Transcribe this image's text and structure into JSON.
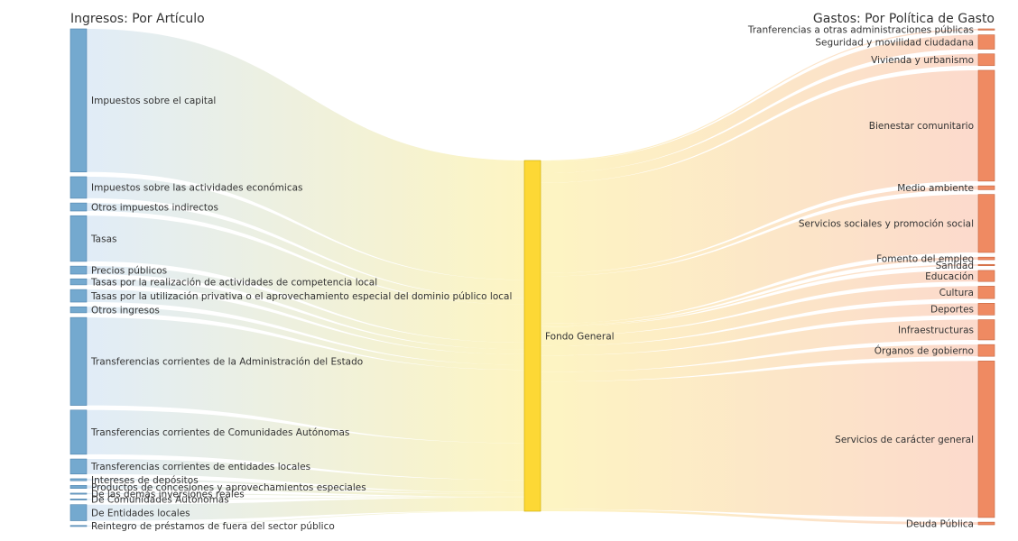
{
  "chart_data": {
    "type": "sankey",
    "title_left": "Ingresos: Por Artículo",
    "title_right": "Gastos: Por Política de Gasto",
    "middle_node": "Fondo General",
    "colors": {
      "income_node": "#74a9cf",
      "middle_node": "#fdd835",
      "expense_node": "#ef8a62",
      "link_from": "#dbe9f6",
      "link_mid": "#fdf3b8",
      "link_to": "#fbd3c3"
    },
    "income": [
      {
        "label": "Impuestos sobre el capital",
        "value": 28.5
      },
      {
        "label": "Impuestos sobre las actividades económicas",
        "value": 4.3
      },
      {
        "label": "Otros impuestos indirectos",
        "value": 1.6
      },
      {
        "label": "Tasas",
        "value": 9.1
      },
      {
        "label": "Precios públicos",
        "value": 1.6
      },
      {
        "label": "Tasas por la realización de actividades de competencia local",
        "value": 1.2
      },
      {
        "label": "Tasas por la utilización privativa o el aprovechamiento especial del dominio público local",
        "value": 2.5
      },
      {
        "label": "Otros ingresos",
        "value": 1.2
      },
      {
        "label": "Transferencias corrientes de la Administración del Estado",
        "value": 17.5
      },
      {
        "label": "Transferencias corrientes de Comunidades Autónomas",
        "value": 8.8
      },
      {
        "label": "Transferencias corrientes de entidades locales",
        "value": 3.0
      },
      {
        "label": "Intereses de depósitos",
        "value": 0.4
      },
      {
        "label": "Productos de concesiones y aprovechamientos especiales",
        "value": 0.6
      },
      {
        "label": "De las demás inversiones reales",
        "value": 0.1
      },
      {
        "label": "De Comunidades Autónomas",
        "value": 0.1
      },
      {
        "label": "De Entidades locales",
        "value": 3.2
      },
      {
        "label": "Reintegro de préstamos de fuera del sector público",
        "value": 0.1
      }
    ],
    "expenses": [
      {
        "label": "Tranferencias a otras administraciones públicas",
        "value": 0.2
      },
      {
        "label": "Seguridad y movilidad ciudadana",
        "value": 2.2
      },
      {
        "label": "Vivienda y urbanismo",
        "value": 1.8
      },
      {
        "label": "Bienestar comunitario",
        "value": 17.0
      },
      {
        "label": "Medio ambiente",
        "value": 0.6
      },
      {
        "label": "Servicios sociales y promoción social",
        "value": 8.9
      },
      {
        "label": "Fomento del empleo",
        "value": 0.4
      },
      {
        "label": "Sanidad",
        "value": 0.2
      },
      {
        "label": "Educación",
        "value": 1.7
      },
      {
        "label": "Cultura",
        "value": 1.9
      },
      {
        "label": "Deportes",
        "value": 1.8
      },
      {
        "label": "Infraestructuras",
        "value": 3.1
      },
      {
        "label": "Órganos de gobierno",
        "value": 1.8
      },
      {
        "label": "Servicios de carácter general",
        "value": 24.0
      },
      {
        "label": "Deuda Pública",
        "value": 0.4
      }
    ]
  }
}
